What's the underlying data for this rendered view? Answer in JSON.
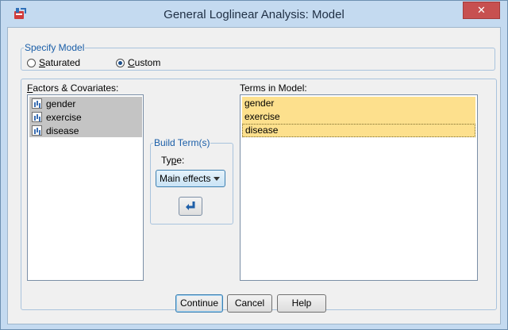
{
  "window": {
    "title": "General Loglinear Analysis: Model",
    "close_glyph": "✕"
  },
  "specify_model": {
    "legend": "Specify Model",
    "options": [
      {
        "label": "Saturated",
        "mnemonic": "S",
        "rest": "aturated",
        "checked": false
      },
      {
        "label": "Custom",
        "mnemonic": "C",
        "rest": "ustom",
        "checked": true
      }
    ]
  },
  "factors": {
    "caption_mnemonic": "F",
    "caption_rest": "actors & Covariates:",
    "items": [
      "gender",
      "exercise",
      "disease"
    ]
  },
  "build_term": {
    "legend": "Build Term(s)",
    "type_prefix": "Ty",
    "type_mnemonic": "p",
    "type_suffix": "e:",
    "type_value": "Main effects",
    "move_icon": "arrow-move-icon"
  },
  "terms": {
    "caption": "Terms in Model:",
    "items": [
      "gender",
      "exercise",
      "disease"
    ]
  },
  "buttons": {
    "continue": "Continue",
    "cancel": "Cancel",
    "help": "Help"
  },
  "colors": {
    "title_bar": "#c4daf0",
    "close": "#c75050",
    "selected_term": "#fde08d",
    "group_legend": "#1a5ea8"
  }
}
